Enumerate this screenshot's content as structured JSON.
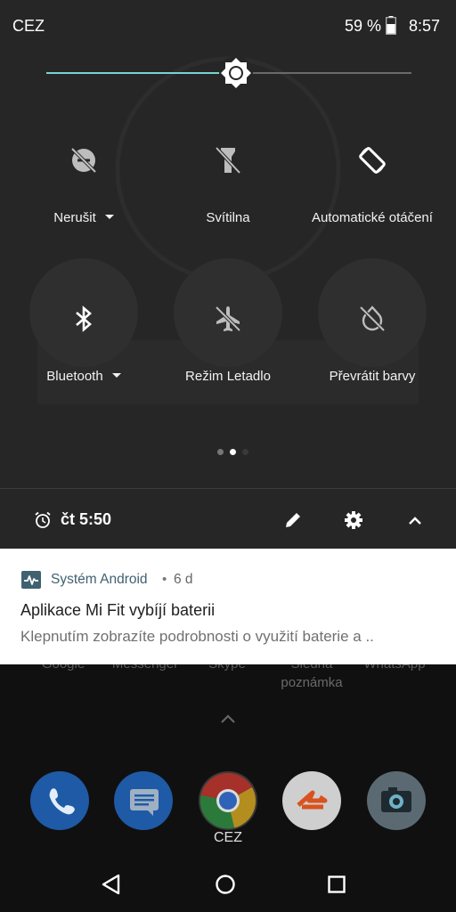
{
  "status_bar": {
    "carrier": "CEZ",
    "battery_percent": "59 %",
    "time": "8:57"
  },
  "brightness": {
    "level": 0.52
  },
  "tiles": [
    {
      "label": "Nerušit",
      "icon": "do-not-disturb-off-icon",
      "has_menu": true
    },
    {
      "label": "Svítilna",
      "icon": "flashlight-off-icon",
      "has_menu": false
    },
    {
      "label": "Automatické otáčení",
      "icon": "auto-rotate-icon",
      "has_menu": false
    },
    {
      "label": "Bluetooth",
      "icon": "bluetooth-icon",
      "has_menu": true
    },
    {
      "label": "Režim Letadlo",
      "icon": "airplane-mode-off-icon",
      "has_menu": false
    },
    {
      "label": "Převrátit barvy",
      "icon": "invert-colors-off-icon",
      "has_menu": false
    }
  ],
  "pager": {
    "pages": 3,
    "current": 1
  },
  "footer": {
    "alarm": "čt 5:50"
  },
  "notification": {
    "app": "Systém Android",
    "separator": "•",
    "time": "6 d",
    "title": "Aplikace Mi Fit vybíjí baterii",
    "text": "Klepnutím zobrazíte podrobnosti o využití baterie a ..",
    "accent": "#3f6170"
  },
  "home": {
    "app_labels": [
      "Google",
      "Messenger",
      "Skype",
      "Sledná",
      "WhatsApp",
      "poznámka"
    ],
    "dock_label": "CEZ",
    "dock": [
      "phone-icon",
      "messages-icon",
      "chrome-icon",
      "flashlight-app-icon",
      "camera-icon"
    ]
  },
  "colors": {
    "panel": "#262626",
    "accent": "#79d3d2"
  }
}
